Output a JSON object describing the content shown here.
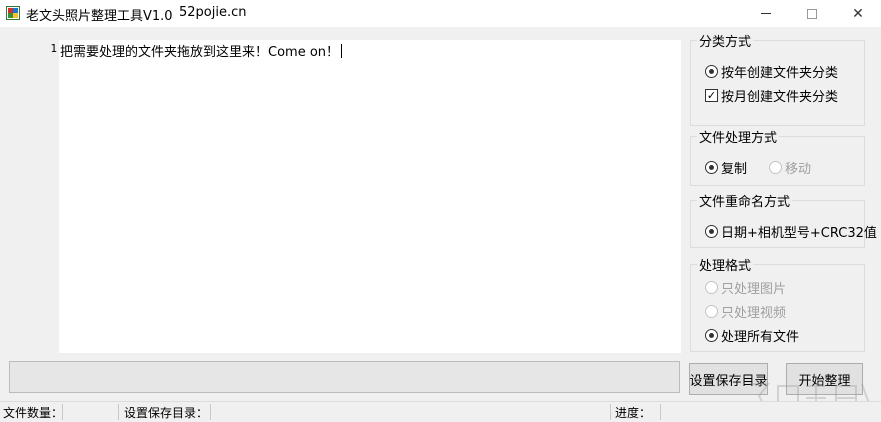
{
  "window": {
    "title": "老文头照片整理工具V1.0",
    "site": "52pojie.cn",
    "minimize_icon": "minimize-icon",
    "maximize_icon": "maximize-icon",
    "close_icon": "close-icon",
    "close_glyph": "✕"
  },
  "editor": {
    "line_number": "1",
    "text": "把需要处理的文件夹拖放到这里来！Come on！"
  },
  "classify": {
    "title": "分类方式",
    "options": [
      {
        "label": "按年创建文件夹分类",
        "type": "radio",
        "checked": true,
        "enabled": true
      },
      {
        "label": "按月创建文件夹分类",
        "type": "checkbox",
        "checked": true,
        "enabled": true
      }
    ],
    "checkbox_mark": "✓"
  },
  "file_mode": {
    "title": "文件处理方式",
    "options": [
      {
        "label": "复制",
        "checked": true,
        "enabled": true
      },
      {
        "label": "移动",
        "checked": false,
        "enabled": false
      }
    ]
  },
  "rename": {
    "title": "文件重命名方式",
    "options": [
      {
        "label": "日期+相机型号+CRC32值",
        "checked": true,
        "enabled": true
      }
    ]
  },
  "format": {
    "title": "处理格式",
    "options": [
      {
        "label": "只处理图片",
        "checked": false,
        "enabled": false
      },
      {
        "label": "只处理视频",
        "checked": false,
        "enabled": false
      },
      {
        "label": "处理所有文件",
        "checked": true,
        "enabled": true
      }
    ]
  },
  "progress": {
    "value": 0
  },
  "buttons": {
    "save_dir": "设置保存目录",
    "start": "开始整理"
  },
  "status": {
    "file_count_label": "文件数量：",
    "save_dir_label": "设置保存目录：",
    "progress_label": "进度："
  },
  "colors": {
    "background": "#f0f0f0",
    "editor_bg": "#ffffff",
    "disabled_text": "#a0a0a0"
  }
}
